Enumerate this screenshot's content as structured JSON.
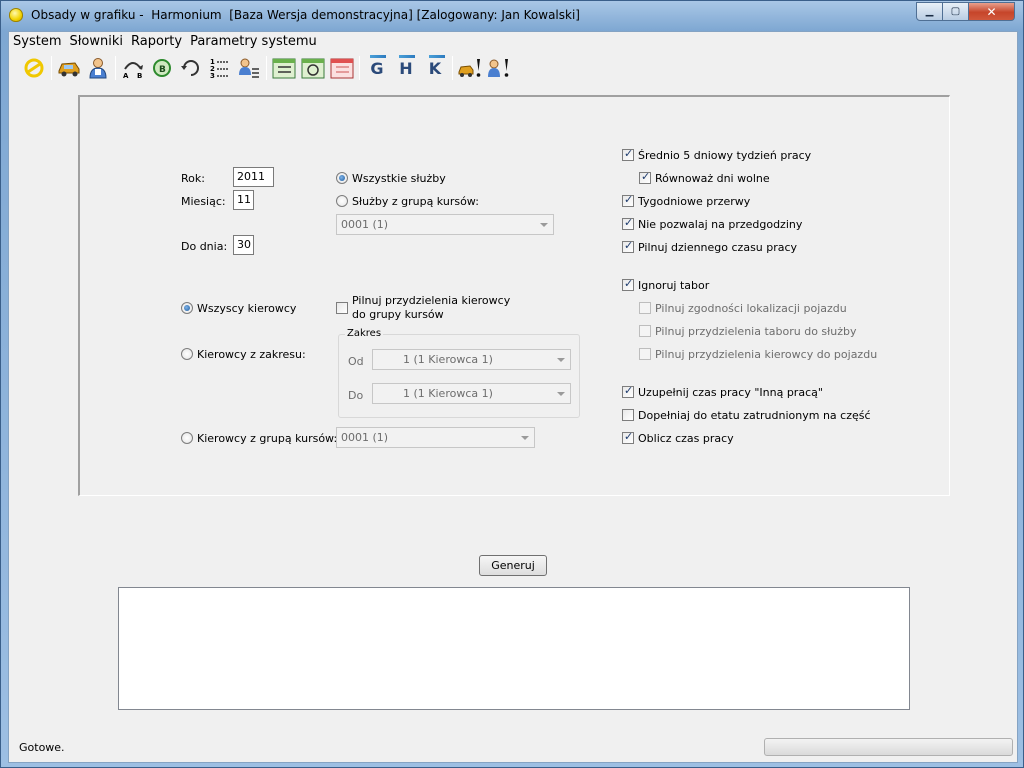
{
  "window": {
    "title": "Obsady w grafiku -  Harmonium  [Baza Wersja demonstracyjna] [Zalogowany: Jan Kowalski]",
    "min_glyph": "▁",
    "max_glyph": "▢",
    "close_glyph": "✕"
  },
  "menu": [
    "System",
    "Słowniki",
    "Raporty",
    "Parametry systemu"
  ],
  "toolbar": {
    "icons": [
      "sun-icon",
      "car-icon",
      "person-icon",
      "route-ab-icon",
      "route-recycle-icon",
      "refresh-icon",
      "numbered-list-icon",
      "person-list-icon",
      "calendar-list-icon",
      "calendar-refresh-icon",
      "calendar-red-icon",
      "g-icon",
      "h-icon",
      "k-icon",
      "car-warning-icon",
      "person-warning-icon"
    ],
    "letters": {
      "g": "G",
      "h": "H",
      "k": "K"
    }
  },
  "form": {
    "rok_label": "Rok:",
    "rok_value": "2011",
    "miesiac_label": "Miesiąc:",
    "miesiac_value": "11",
    "do_dnia_label": "Do dnia:",
    "do_dnia_value": "30",
    "wszystkie_sluzby_label": "Wszystkie służby",
    "wszystkie_sluzby_checked": true,
    "sluzby_z_grupa_label": "Służby z grupą kursów:",
    "sluzby_z_grupa_checked": false,
    "sluzby_combo_value": "0001   (1)",
    "wszyscy_kierowcy_label": "Wszyscy kierowcy",
    "wszyscy_kierowcy_checked": true,
    "pilnuj_grupy_label_1": "Pilnuj przydzielenia kierowcy",
    "pilnuj_grupy_label_2": "do grupy kursów",
    "pilnuj_grupy_checked": false,
    "kierowcy_zakres_label": "Kierowcy z zakresu:",
    "kierowcy_zakres_checked": false,
    "zakres_title": "Zakres",
    "od_label": "Od",
    "od_value": "1   (1 Kierowca 1)",
    "do_label": "Do",
    "do_value": "1   (1 Kierowca 1)",
    "kierowcy_grupa_label": "Kierowcy z grupą kursów:",
    "kierowcy_grupa_checked": false,
    "kierowcy_grupa_combo": "0001   (1)"
  },
  "options": [
    {
      "label": "Średnio 5 dniowy tydzień pracy",
      "checked": true,
      "enabled": true
    },
    {
      "label": "Równoważ dni wolne",
      "checked": true,
      "enabled": true
    },
    {
      "label": "Tygodniowe przerwy",
      "checked": true,
      "enabled": true
    },
    {
      "label": "Nie pozwalaj na przedgodziny",
      "checked": true,
      "enabled": true
    },
    {
      "label": "Pilnuj dziennego czasu pracy",
      "checked": true,
      "enabled": true
    },
    {
      "label": "Ignoruj tabor",
      "checked": true,
      "enabled": true
    },
    {
      "label": "Pilnuj zgodności lokalizacji pojazdu",
      "checked": false,
      "enabled": false
    },
    {
      "label": "Pilnuj przydzielenia taboru do służby",
      "checked": false,
      "enabled": false
    },
    {
      "label": "Pilnuj przydzielenia kierowcy do pojazdu",
      "checked": false,
      "enabled": false
    },
    {
      "label": "Uzupełnij czas pracy \"Inną pracą\"",
      "checked": true,
      "enabled": true
    },
    {
      "label": "Dopełniaj do etatu zatrudnionym na część",
      "checked": false,
      "enabled": true
    },
    {
      "label": "Oblicz czas pracy",
      "checked": true,
      "enabled": true
    }
  ],
  "generate_button": "Generuj",
  "log_text": "",
  "status": {
    "text": "Gotowe.",
    "progress": 0
  },
  "colors": {
    "accent": "#1c5b9e",
    "progress_green": "#3ec43a"
  }
}
